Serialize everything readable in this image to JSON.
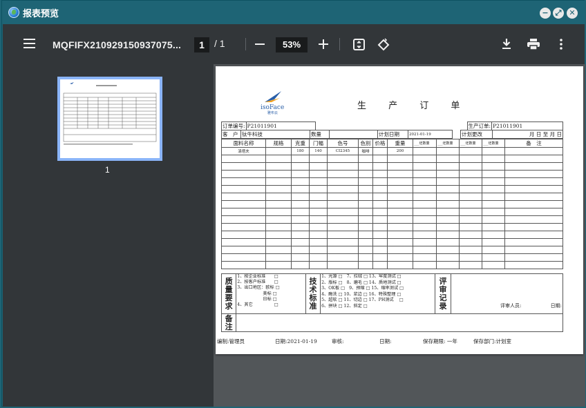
{
  "window": {
    "title": "报表预览",
    "buttons": [
      "minimize-button",
      "maximize-button",
      "close-button"
    ]
  },
  "toolbar": {
    "doc_name": "MQFIFX210929150937075...",
    "page_current": "1",
    "page_sep": "/",
    "page_total": "1",
    "zoom": "53%"
  },
  "sidebar": {
    "thumb_label": "1"
  },
  "document": {
    "company": "isoFace",
    "company_cn": "雅布云",
    "title": "生 产 订 单",
    "order_no_label": "订单编号:",
    "order_no": "P21011901",
    "prod_order_label": "生产订单:",
    "prod_order": "P21011901",
    "customer_label": "客　户",
    "customer": "钛牛科技",
    "qty_label": "数量",
    "plan_date_label": "计划日期",
    "plan_date": "2021-01-19",
    "plan_change_label": "计划更改",
    "plan_change_val": "月  日 至  月  日",
    "headers": [
      "面料名称",
      "规格",
      "克重",
      "门幅",
      "色号",
      "色别",
      "价格",
      "重量",
      "___坯数量",
      "___坯数量",
      "___坯数量",
      "___坯数量",
      "备　注"
    ],
    "row1": [
      "涤塔夫",
      "",
      "180",
      "140",
      "CI2345",
      "咖啡",
      "",
      "200",
      "",
      "",
      "",
      "",
      ""
    ],
    "quality_label": "质量要求",
    "quality_items": [
      "1、按企业标准　　□",
      "2、按客户标准　　□",
      "3、出口地区：欧标 □",
      "　　　　　　美标 □",
      "　　　　　　日标 □",
      "4、其它　　　　　□"
    ],
    "tech_label": "技术标准",
    "tech_items": [
      "1、光源 □　7、拉绒 □ 13、牢度测试 □",
      "2、版标 □　8、磨毛 □ 14、质地测试 □",
      "3、OK板 □　9、预缩 □ 15、缩率测试 □",
      "4、酶洗 □ 10、浆边 □ 16、特殊整理 □",
      "5、超软 □ 11、切边 □ 17、PH测试　 □",
      "6、拼块 □ 12、斜定 □"
    ],
    "review_label": "评审记录",
    "reviewer_label": "评审人员:",
    "review_date_label": "日期:",
    "remark_label": "备注",
    "footer": {
      "editor": "编制:管理员",
      "date": "日期:2021-01-19",
      "reviewer": "审核:",
      "date2": "日期:",
      "keep": "保存期限: 一年",
      "dept": "保存部门:计划室"
    }
  },
  "colors": {
    "titlebar": "#1e6475",
    "toolbar": "#323639",
    "viewer_bg": "#525659",
    "accent": "#8ab4f8"
  }
}
